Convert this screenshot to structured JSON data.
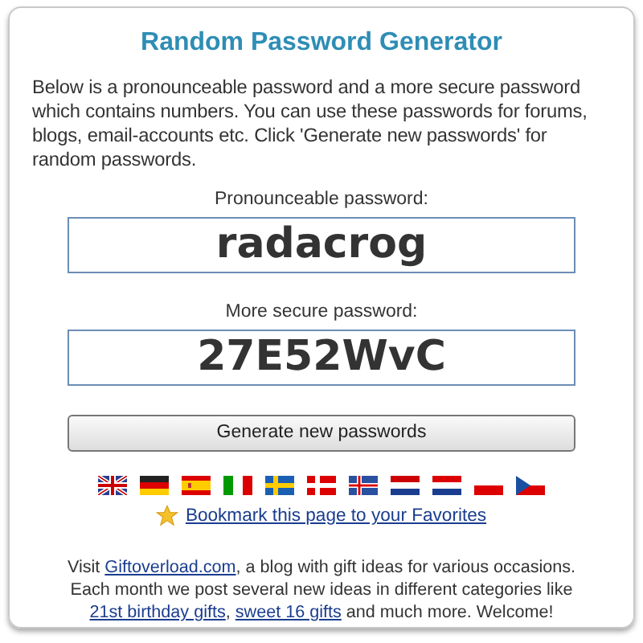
{
  "title": "Random Password Generator",
  "intro": "Below is a pronounceable password and a more secure password which contains numbers. You can use these passwords for forums, blogs, email-accounts etc. Click 'Generate new passwords' for random passwords.",
  "passwords": [
    {
      "label": "Pronounceable password:",
      "value": "radacrog"
    },
    {
      "label": "More secure password:",
      "value": "27E52WvC"
    }
  ],
  "button": "Generate new passwords",
  "bookmark": "Bookmark this page to your Favorites",
  "footer": [
    [
      {
        "before": "Visit ",
        "link": "Giftoverload.com",
        "after": ", a blog with gift ideas for various occasions."
      }
    ],
    [
      {
        "before": "Each month we post several new ideas in different categories like"
      }
    ],
    [
      {
        "link": "21st birthday gifts",
        "after": ", "
      },
      {
        "link": "sweet 16 gifts",
        "after": " and much more. Welcome!"
      }
    ]
  ]
}
